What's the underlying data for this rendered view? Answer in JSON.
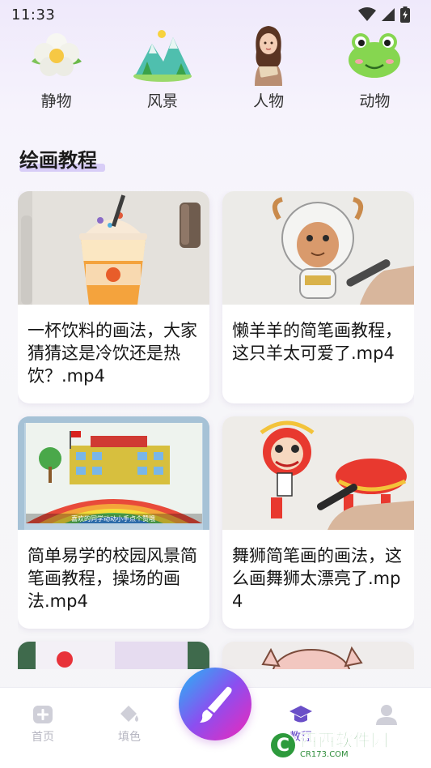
{
  "status": {
    "time": "11:33"
  },
  "categories": [
    {
      "label": "静物",
      "icon": "flower-icon"
    },
    {
      "label": "风景",
      "icon": "mountain-icon"
    },
    {
      "label": "人物",
      "icon": "person-icon"
    },
    {
      "label": "动物",
      "icon": "frog-icon"
    }
  ],
  "section": {
    "title": "绘画教程"
  },
  "videos": [
    {
      "title": "一杯饮料的画法，大家猜猜这是冷饮还是热饮？.mp4"
    },
    {
      "title": "懒羊羊的简笔画教程，这只羊太可爱了.mp4"
    },
    {
      "title": "简单易学的校园风景简笔画教程，操场的画法.mp4"
    },
    {
      "title": "舞狮简笔画的画法，这么画舞狮太漂亮了.mp4"
    }
  ],
  "thumb_text": {
    "video3_caption": "喜欢的同学动动小手点个赞哦"
  },
  "tabbar": {
    "home": "首页",
    "fill": "填色",
    "tutorial": "教程"
  },
  "watermark": {
    "badge": "C",
    "main": "西西软件园",
    "sub": "CR173.COM"
  },
  "colors": {
    "accent": "#8b4ff0",
    "tab_inactive": "#b7b7c2",
    "tab_active": "#6a4fc8"
  }
}
